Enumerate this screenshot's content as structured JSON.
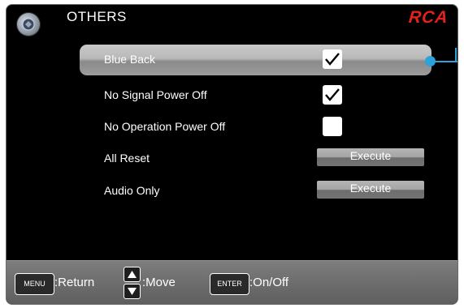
{
  "header": {
    "title": "OTHERS",
    "brand": "RCA"
  },
  "menu": {
    "items": [
      {
        "label": "Blue Back",
        "control": "checkbox",
        "checked": true,
        "selected": true
      },
      {
        "label": "No Signal Power Off",
        "control": "checkbox",
        "checked": true,
        "selected": false
      },
      {
        "label": "No Operation Power Off",
        "control": "checkbox",
        "checked": false,
        "selected": false
      },
      {
        "label": "All Reset",
        "control": "button",
        "button_label": "Execute",
        "selected": false
      },
      {
        "label": "Audio Only",
        "control": "button",
        "button_label": "Execute",
        "selected": false
      }
    ]
  },
  "footer": {
    "menu_key": "MENU",
    "menu_action": ":Return",
    "move_action": ":Move",
    "enter_key": "ENTER",
    "enter_action": ":On/Off"
  },
  "colors": {
    "background": "#000000",
    "accent": "#29a3d9",
    "brand": "#e3231b",
    "highlight": "#b5b5b5"
  }
}
